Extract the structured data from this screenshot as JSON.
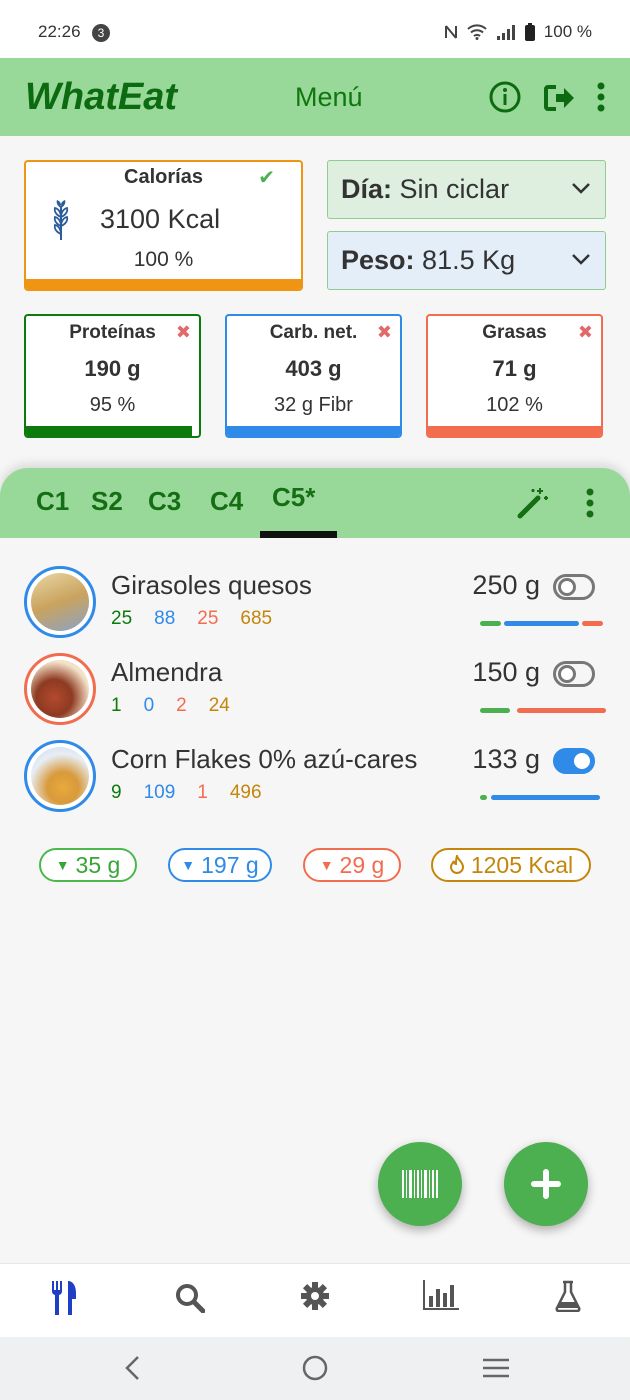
{
  "status": {
    "time": "22:26",
    "badge": "3",
    "battery": "100 %"
  },
  "appbar": {
    "title": "WhatEat",
    "menu": "Menú"
  },
  "calories": {
    "title": "Calorías",
    "value": "3100 Kcal",
    "percent": "100 %",
    "progress": 1.0,
    "color": "#f09413"
  },
  "day": {
    "label": "Día:",
    "value": "Sin ciclar"
  },
  "weight": {
    "label": "Peso:",
    "value": "81.5 Kg"
  },
  "macros": [
    {
      "title": "Proteínas",
      "value": "190 g",
      "sub": "95 %",
      "color": "#0d7a0d",
      "progress": 0.95
    },
    {
      "title": "Carb. net.",
      "value": "403 g",
      "sub": "32 g Fibr",
      "color": "#2f8ae8",
      "progress": 1.0
    },
    {
      "title": "Grasas",
      "value": "71 g",
      "sub": "102 %",
      "color": "#f26c4f",
      "progress": 1.0
    }
  ],
  "tabs": [
    "C1",
    "S2",
    "C3",
    "C4",
    "C5*"
  ],
  "active_tab": "C5*",
  "foods": [
    {
      "name": "Girasoles quesos",
      "protein": "25",
      "carbs": "88",
      "fat": "25",
      "kcal": "685",
      "grams": "250 g",
      "enabled": false,
      "ring": "#2f8ae8"
    },
    {
      "name": "Almendra",
      "protein": "1",
      "carbs": "0",
      "fat": "2",
      "kcal": "24",
      "grams": "150 g",
      "enabled": false,
      "ring": "#f26c4f"
    },
    {
      "name": "Corn Flakes 0% azú-cares",
      "protein": "9",
      "carbs": "109",
      "fat": "1",
      "kcal": "496",
      "grams": "133 g",
      "enabled": true,
      "ring": "#2f8ae8"
    }
  ],
  "totals": {
    "protein": "35 g",
    "carbs": "197 g",
    "fat": "29 g",
    "kcal": "1205 Kcal"
  },
  "colors": {
    "green_bar": "#98d999",
    "protein": "#0d7a0d",
    "carbs": "#2f8ae8",
    "fat": "#f26c4f",
    "kcal": "#c4860a"
  }
}
